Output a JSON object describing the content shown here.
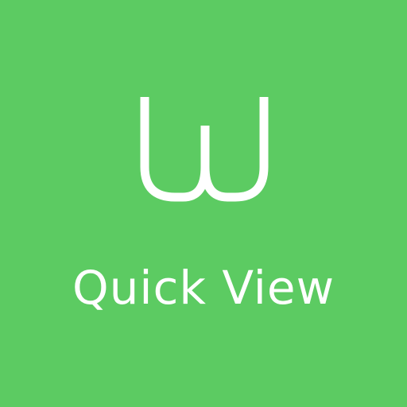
{
  "app": {
    "name": "Quick View",
    "logo_letter": "W",
    "logo_icon": "w-letter-icon"
  },
  "colors": {
    "background": "#5ccb62",
    "foreground": "#ffffff"
  }
}
